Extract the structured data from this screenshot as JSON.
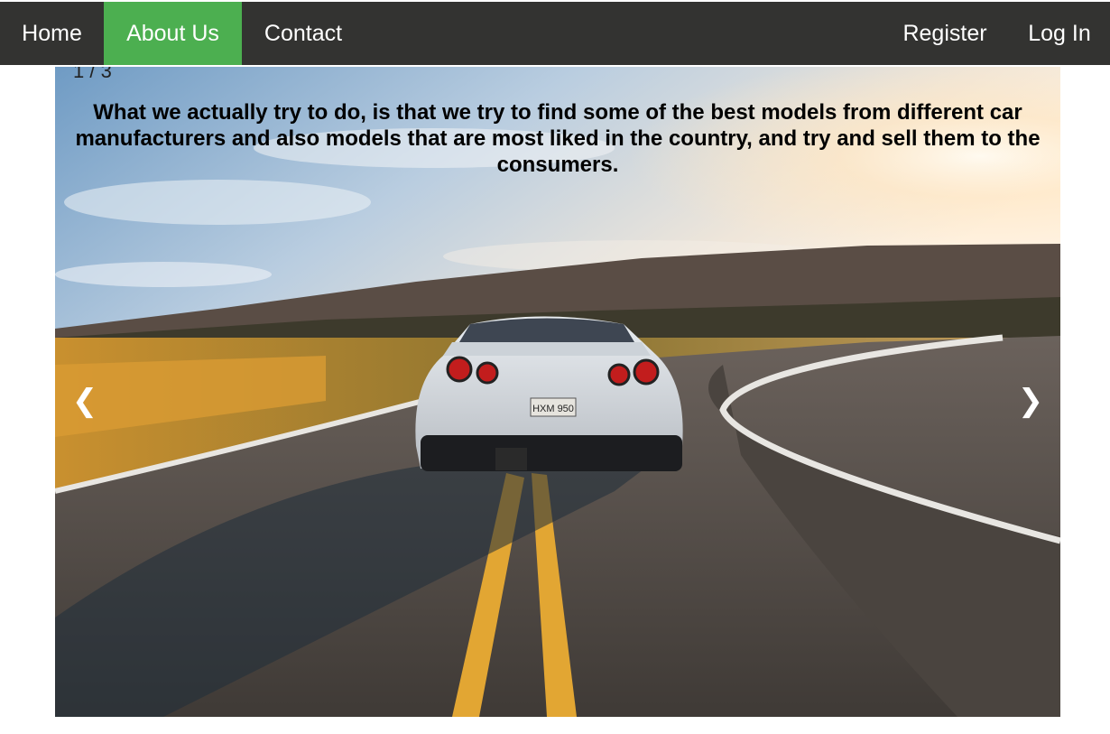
{
  "nav": {
    "home": "Home",
    "about": "About Us",
    "contact": "Contact",
    "register": "Register",
    "login": "Log In",
    "active_color": "#4caf50",
    "bar_color": "#333331"
  },
  "slideshow": {
    "counter": "1 / 3",
    "caption": "What we actually try to do, is that we try to find some of the best models from different car manufacturers and also models that are most liked in the country, and try and sell them to the consumers.",
    "prev_icon": "❮",
    "next_icon": "❯",
    "plate_text": "HXM 950"
  }
}
